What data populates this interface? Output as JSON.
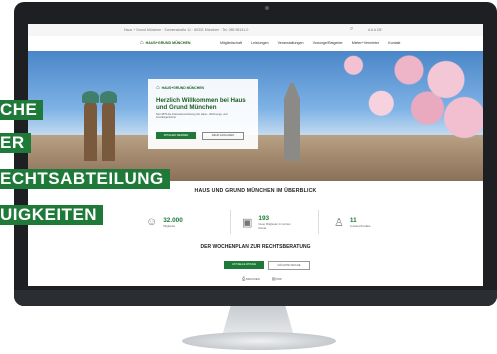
{
  "topbar": {
    "address": "Haus + Grund München · Sonnenstraße 11 · 80331 München · Tel. 089 55141-0",
    "lang": "A  A  A  DE"
  },
  "nav": {
    "logo": "HAUS+GRUND MÜNCHEN",
    "items": [
      "Mitgliedschaft",
      "Leistungen",
      "Veranstaltungen",
      "Vorsorge/Ratgeber",
      "Mieter+Vermieter",
      "Kontakt"
    ]
  },
  "hero": {
    "card_logo": "HAUS+GRUND MÜNCHEN",
    "heading": "Herzlich Willkommen bei Haus und Grund München",
    "text": "Seit 1879 die Interessenvertretung der Haus-, Wohnungs- und Grundeigentümer",
    "primary_button": "MITGLIED WERDEN",
    "secondary_button": "MEHR ERFAHREN"
  },
  "overview": {
    "title": "HAUS UND GRUND MÜNCHEN IM ÜBERBLICK",
    "stats": [
      {
        "icon": "people-icon",
        "number": "32.000",
        "label": "Mitglieder"
      },
      {
        "icon": "id-card-icon",
        "number": "193",
        "label": "Neue Mitglieder im letzten Monat"
      },
      {
        "icon": "person-icon",
        "number": "11",
        "label": "Juristen/Anwälte"
      }
    ]
  },
  "plan": {
    "title": "DER WOCHENPLAN ZUR RECHTSBERATUNG",
    "buttons": [
      "AKTUELLE WOCHE",
      "NÄCHSTE WOCHE"
    ],
    "links": [
      "DRUCKEN",
      "PDF"
    ]
  },
  "banners": [
    "CHE",
    "ER",
    "ECHTSABTEILUNG",
    "UIGKEITEN"
  ],
  "colors": {
    "brand_green": "#1f7a3a",
    "dark_green": "#1b5e20"
  }
}
